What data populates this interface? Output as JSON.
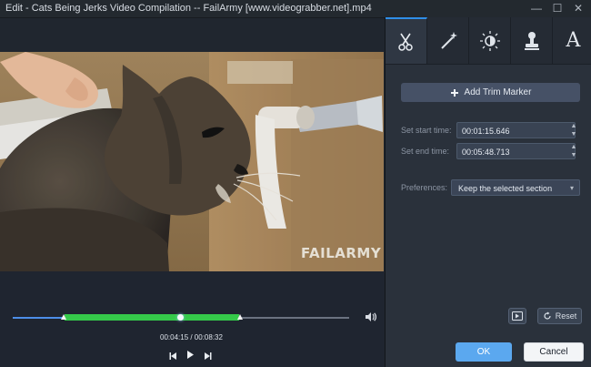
{
  "window": {
    "title": "Edit - Cats Being Jerks Video Compilation -- FailArmy [www.videograbber.net].mp4",
    "controls": {
      "minimize": "—",
      "maximize": "☐",
      "close": "✕"
    }
  },
  "video": {
    "watermark": "FAILARMY",
    "progress_fraction": 0.497,
    "selection": {
      "start_fraction": 0.155,
      "end_fraction": 0.672
    },
    "time_display": "00:04:15 / 00:08:32"
  },
  "playback": {
    "previous_icon": "step-back-icon",
    "play_icon": "play-icon",
    "next_icon": "step-forward-icon",
    "volume_icon": "speaker-icon"
  },
  "tabs": [
    {
      "name": "trim",
      "icon": "scissors-icon"
    },
    {
      "name": "effects",
      "icon": "magic-wand-icon"
    },
    {
      "name": "adjust",
      "icon": "brightness-icon"
    },
    {
      "name": "watermark",
      "icon": "stamp-icon"
    },
    {
      "name": "text",
      "icon": "text-icon",
      "glyph": "A"
    }
  ],
  "trim": {
    "add_marker_label": "Add Trim Marker",
    "start_label": "Set start time:",
    "start_value": "00:01:15.646",
    "end_label": "Set end time:",
    "end_value": "00:05:48.713",
    "preferences_label": "Preferences:",
    "preferences_value": "Keep the selected section",
    "reset_label": "Reset"
  },
  "footer": {
    "ok_label": "OK",
    "cancel_label": "Cancel"
  },
  "colors": {
    "accent": "#2f8ee8",
    "trim_selection": "#35c94a",
    "ok_button": "#5ba8ef"
  }
}
